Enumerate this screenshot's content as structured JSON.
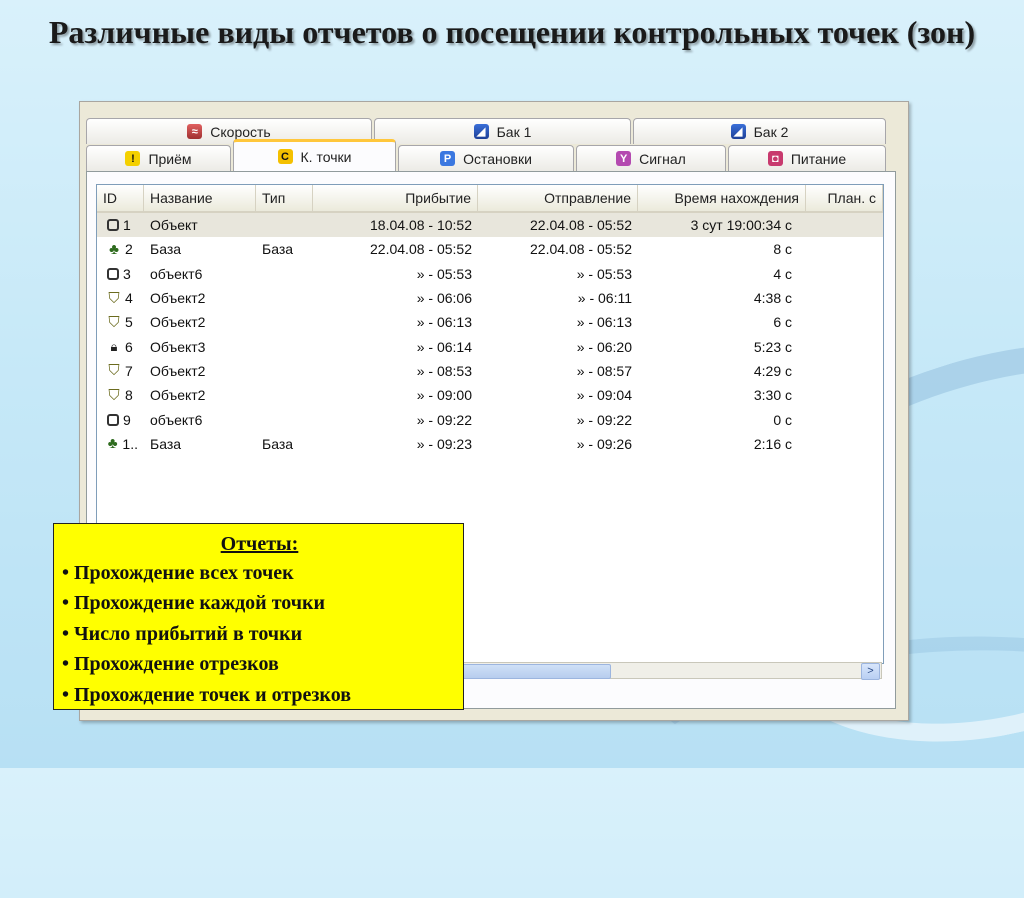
{
  "slide": {
    "title": "Различные виды отчетов о посещении контрольных точек (зон)"
  },
  "tabs": {
    "row1": [
      {
        "label": "Скорость",
        "icon": "speed-icon"
      },
      {
        "label": "Бак 1",
        "icon": "tank-icon"
      },
      {
        "label": "Бак 2",
        "icon": "tank-icon"
      }
    ],
    "row2": [
      {
        "label": "Приём",
        "icon": "warning-icon"
      },
      {
        "label": "К. точки",
        "icon": "checkpoint-icon",
        "active": true
      },
      {
        "label": "Остановки",
        "icon": "parking-icon"
      },
      {
        "label": "Сигнал",
        "icon": "signal-icon"
      },
      {
        "label": "Питание",
        "icon": "power-icon"
      }
    ]
  },
  "table": {
    "columns": [
      "ID",
      "Название",
      "Тип",
      "Прибытие",
      "Отправление",
      "Время нахождения",
      "План. с"
    ],
    "rows": [
      {
        "icon": "square-icon",
        "id": "1",
        "name": "Объект",
        "type": "",
        "arrival": "18.04.08 - 10:52",
        "departure": "22.04.08 - 05:52",
        "duration": "3 сут 19:00:34 с",
        "selected": true
      },
      {
        "icon": "tree-icon",
        "id": "2",
        "name": "База",
        "type": "База",
        "arrival": "22.04.08 - 05:52",
        "departure": "22.04.08 - 05:52",
        "duration": "8 с"
      },
      {
        "icon": "square-icon",
        "id": "3",
        "name": "объект6",
        "type": "",
        "arrival": "» - 05:53",
        "departure": "» - 05:53",
        "duration": "4 с"
      },
      {
        "icon": "shield-icon",
        "id": "4",
        "name": "Объект2",
        "type": "",
        "arrival": "» - 06:06",
        "departure": "» - 06:11",
        "duration": "4:38 с"
      },
      {
        "icon": "shield-icon",
        "id": "5",
        "name": "Объект2",
        "type": "",
        "arrival": "» - 06:13",
        "departure": "» - 06:13",
        "duration": "6 с"
      },
      {
        "icon": "lock-icon",
        "id": "6",
        "name": "Объект3",
        "type": "",
        "arrival": "» - 06:14",
        "departure": "» - 06:20",
        "duration": "5:23 с"
      },
      {
        "icon": "shield-icon",
        "id": "7",
        "name": "Объект2",
        "type": "",
        "arrival": "» - 08:53",
        "departure": "» - 08:57",
        "duration": "4:29 с"
      },
      {
        "icon": "shield-icon",
        "id": "8",
        "name": "Объект2",
        "type": "",
        "arrival": "» - 09:00",
        "departure": "» - 09:04",
        "duration": "3:30 с"
      },
      {
        "icon": "square-icon",
        "id": "9",
        "name": "объект6",
        "type": "",
        "arrival": "» - 09:22",
        "departure": "» - 09:22",
        "duration": "0 с"
      },
      {
        "icon": "tree-icon",
        "id": "1..",
        "name": "База",
        "type": "База",
        "arrival": "» - 09:23",
        "departure": "» - 09:26",
        "duration": "2:16 с"
      }
    ]
  },
  "callout": {
    "heading": "Отчеты:",
    "items": [
      "• Прохождение всех точек",
      "• Прохождение каждой точки",
      "• Число прибытий в точки",
      "• Прохождение отрезков",
      "• Прохождение точек и отрезков"
    ]
  },
  "colors": {
    "callout_bg": "#ffff00",
    "active_tab_accent": "#ffc73c",
    "selected_row": "#e8e6dc"
  }
}
